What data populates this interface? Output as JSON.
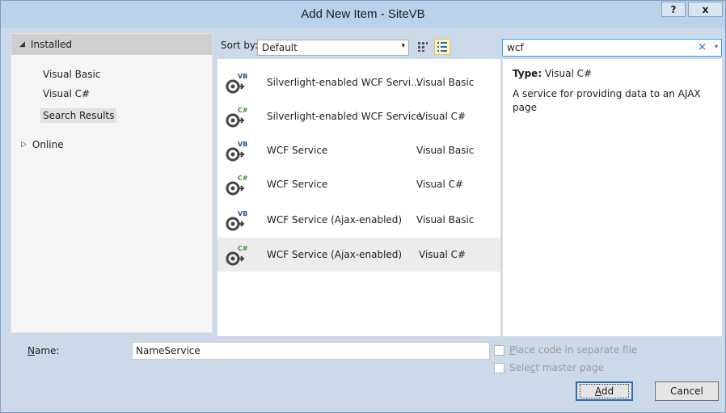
{
  "window": {
    "title": "Add New Item - SiteVB",
    "help_label": "?",
    "close_label": "x"
  },
  "left": {
    "installed_label": "Installed",
    "items": [
      {
        "label": "Visual Basic"
      },
      {
        "label": "Visual C#"
      },
      {
        "label": "Search Results"
      }
    ],
    "online_label": "Online"
  },
  "toolbar": {
    "sort_label": "Sort by:",
    "sort_value": "Default"
  },
  "search": {
    "value": "wcf",
    "clear_icon": "×"
  },
  "results": [
    {
      "badge": "VB",
      "name": "Silverlight-enabled WCF Servi...",
      "lang": "Visual Basic"
    },
    {
      "badge": "C#",
      "name": "Silverlight-enabled WCF Service",
      "lang": "Visual C#"
    },
    {
      "badge": "VB",
      "name": "WCF Service",
      "lang": "Visual Basic"
    },
    {
      "badge": "C#",
      "name": "WCF Service",
      "lang": "Visual C#"
    },
    {
      "badge": "VB",
      "name": "WCF Service (Ajax-enabled)",
      "lang": "Visual Basic"
    },
    {
      "badge": "C#",
      "name": "WCF Service (Ajax-enabled)",
      "lang": "Visual C#"
    }
  ],
  "detail": {
    "type_label": "Type:",
    "type_value": "Visual C#",
    "description": "A service for providing data to an AJAX page"
  },
  "bottom": {
    "name_label_pre": "N",
    "name_label_rest": "ame:",
    "name_value": "NameService",
    "place_code_pre": "P",
    "place_code_rest": "lace code in separate file",
    "master_pre": "Sele",
    "master_u": "c",
    "master_rest": "t master page",
    "add_pre": "A",
    "add_rest": "dd",
    "cancel_label": "Cancel"
  },
  "colors": {
    "titlebar": "#b9d1ea",
    "dialog_bg": "#ccd9e8",
    "accent": "#3399ff"
  }
}
